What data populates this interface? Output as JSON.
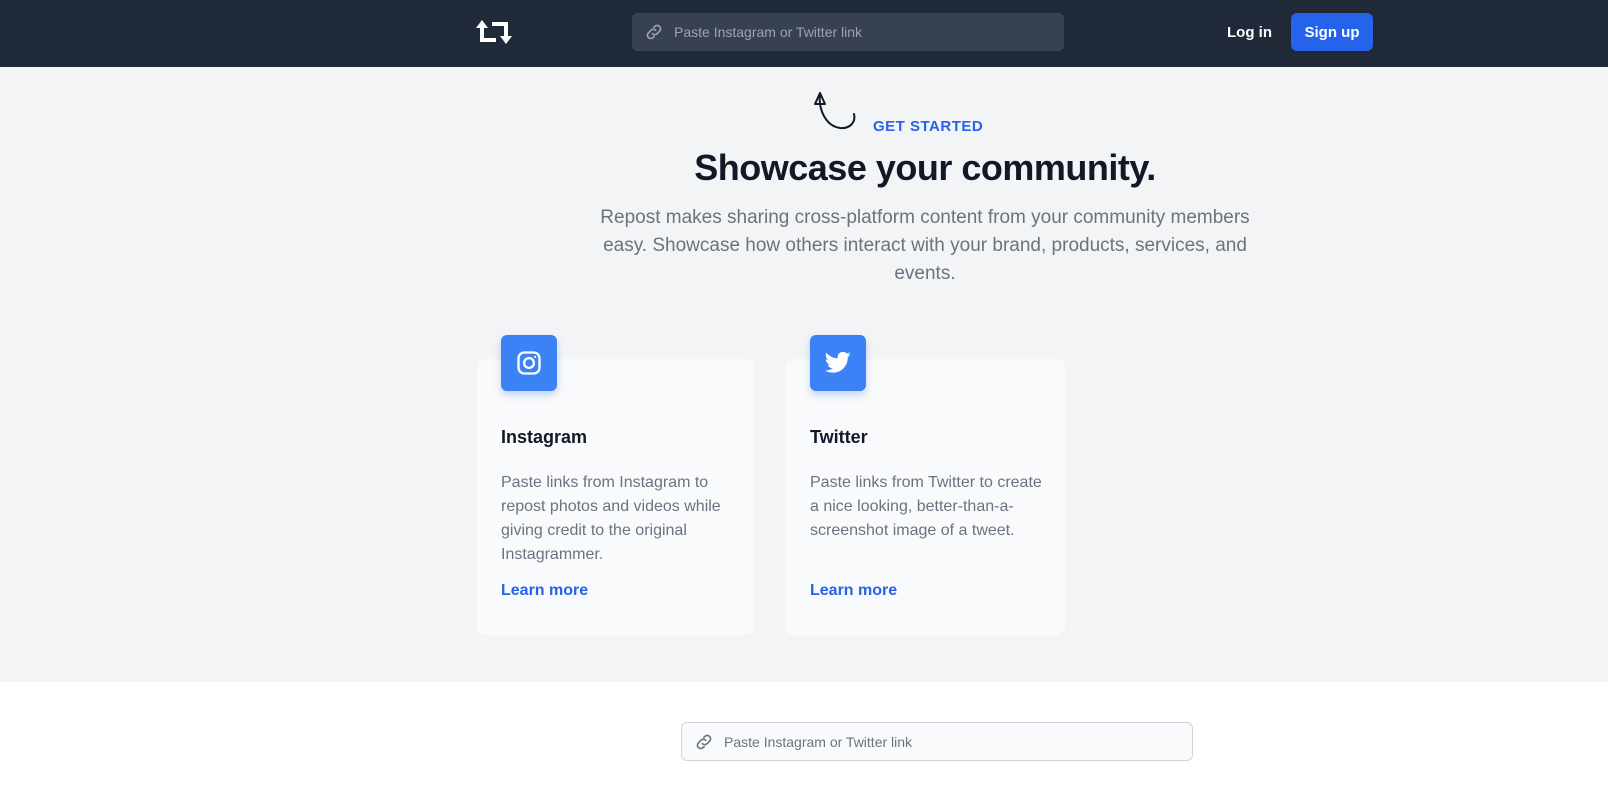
{
  "header": {
    "logo_icon": "repost-icon",
    "search_placeholder": "Paste Instagram or Twitter link",
    "login_label": "Log in",
    "signup_label": "Sign up"
  },
  "hero": {
    "eyebrow": "GET STARTED",
    "headline": "Showcase your community.",
    "lede": "Repost makes sharing cross-platform content from your community members easy. Showcase how others interact with your brand, products, services, and events."
  },
  "cards": [
    {
      "icon": "instagram-icon",
      "title": "Instagram",
      "description": "Paste links from Instagram to repost photos and videos while giving credit to the original Instagrammer.",
      "link": "Learn more"
    },
    {
      "icon": "twitter-icon",
      "title": "Twitter",
      "description": "Paste links from Twitter to create a nice looking, better-than-a-screenshot image of a tweet.",
      "link": "Learn more"
    }
  ],
  "bottom": {
    "search_placeholder": "Paste Instagram or Twitter link"
  },
  "colors": {
    "accent": "#2563eb",
    "icon_tile": "#3b82f6",
    "nav_bg": "#1f2937"
  }
}
